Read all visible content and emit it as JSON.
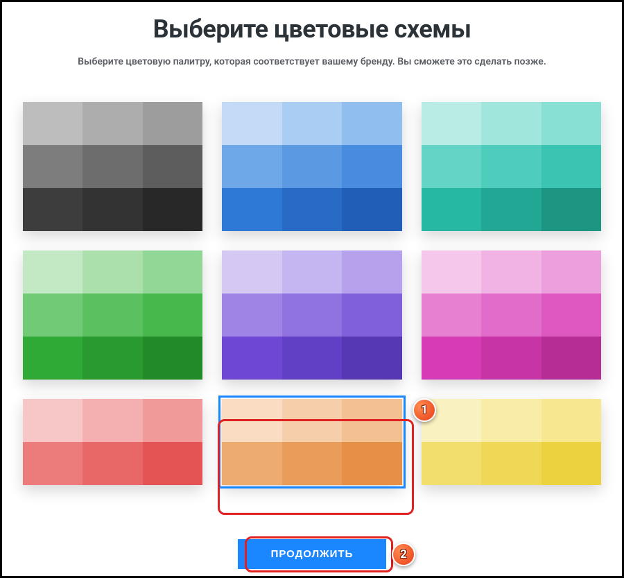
{
  "header": {
    "title": "Выберите цветовые схемы",
    "subtitle": "Выберите цветовую палитру, которая соответствует вашему бренду. Вы сможете это сделать позже."
  },
  "continue_label": "ПРОДОЛЖИТЬ",
  "annotations": {
    "badge1": "1",
    "badge2": "2"
  },
  "palettes": [
    {
      "name": "gray",
      "rows": [
        [
          "#bdbdbd",
          "#adadad",
          "#9d9d9d"
        ],
        [
          "#7d7d7d",
          "#6d6d6d",
          "#5d5d5d"
        ],
        [
          "#3d3d3d",
          "#333333",
          "#282828"
        ]
      ]
    },
    {
      "name": "blue",
      "rows": [
        [
          "#c3dbf7",
          "#aacdf3",
          "#90beef"
        ],
        [
          "#6fa8e8",
          "#5b9ae3",
          "#478cde"
        ],
        [
          "#2e78d6",
          "#276bc7",
          "#215eb7"
        ]
      ]
    },
    {
      "name": "teal",
      "rows": [
        [
          "#b8ece5",
          "#a0e6dd",
          "#88e0d4"
        ],
        [
          "#63d4c5",
          "#4ecdbc",
          "#3ac5b2"
        ],
        [
          "#26b8a3",
          "#21a793",
          "#1c9683"
        ]
      ]
    },
    {
      "name": "green",
      "rows": [
        [
          "#c3e8c4",
          "#abe0ad",
          "#93d796"
        ],
        [
          "#71ca75",
          "#5bc160",
          "#46b84c"
        ],
        [
          "#2faa36",
          "#299a30",
          "#238a2a"
        ]
      ]
    },
    {
      "name": "purple",
      "rows": [
        [
          "#d5c9f4",
          "#c5b5f0",
          "#b5a1ec"
        ],
        [
          "#9f84e5",
          "#9072e0",
          "#8160db"
        ],
        [
          "#6e48d4",
          "#6240c5",
          "#5638b5"
        ]
      ]
    },
    {
      "name": "pink",
      "rows": [
        [
          "#f4c7eb",
          "#f1b3e4",
          "#ed9fdd"
        ],
        [
          "#e780d1",
          "#e26cc9",
          "#dd58c1"
        ],
        [
          "#d53cb5",
          "#c634a6",
          "#b62d96"
        ]
      ]
    },
    {
      "name": "red",
      "short": true,
      "rows": [
        [
          "#f7c6c6",
          "#f4b0b0",
          "#f19a9a"
        ],
        [
          "#ec7c7c",
          "#e86868",
          "#e45454"
        ]
      ]
    },
    {
      "name": "orange",
      "short": true,
      "selected": true,
      "rows": [
        [
          "#f9dcc2",
          "#f6ceaa",
          "#f3c092"
        ],
        [
          "#eeab70",
          "#ea9d5b",
          "#e68f46"
        ]
      ]
    },
    {
      "name": "yellow",
      "short": true,
      "rows": [
        [
          "#faf1c0",
          "#f8eca8",
          "#f6e790"
        ],
        [
          "#f2de6c",
          "#efd856",
          "#edd240"
        ]
      ]
    }
  ]
}
